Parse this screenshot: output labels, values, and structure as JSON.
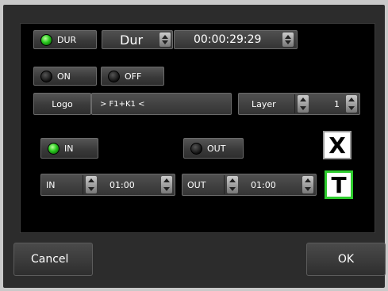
{
  "duration": {
    "dur_toggle": "DUR",
    "mode_value": "Dur",
    "time_value": "00:00:29:29"
  },
  "power": {
    "on_label": "ON",
    "off_label": "OFF"
  },
  "logo": {
    "button_label": "Logo",
    "value": "> F1+K1 <",
    "layer_label": "Layer",
    "layer_value": "1"
  },
  "inout": {
    "in_toggle": "IN",
    "out_toggle": "OUT",
    "in_label": "IN",
    "in_value": "01:00",
    "out_label": "OUT",
    "out_value": "01:00"
  },
  "icons": {
    "close_glyph": "X",
    "text_glyph": "T"
  },
  "footer": {
    "cancel_label": "Cancel",
    "ok_label": "OK"
  },
  "colors": {
    "led_on": "#28c81e",
    "text_icon_border": "#2ecc2e",
    "background": "#000000"
  }
}
